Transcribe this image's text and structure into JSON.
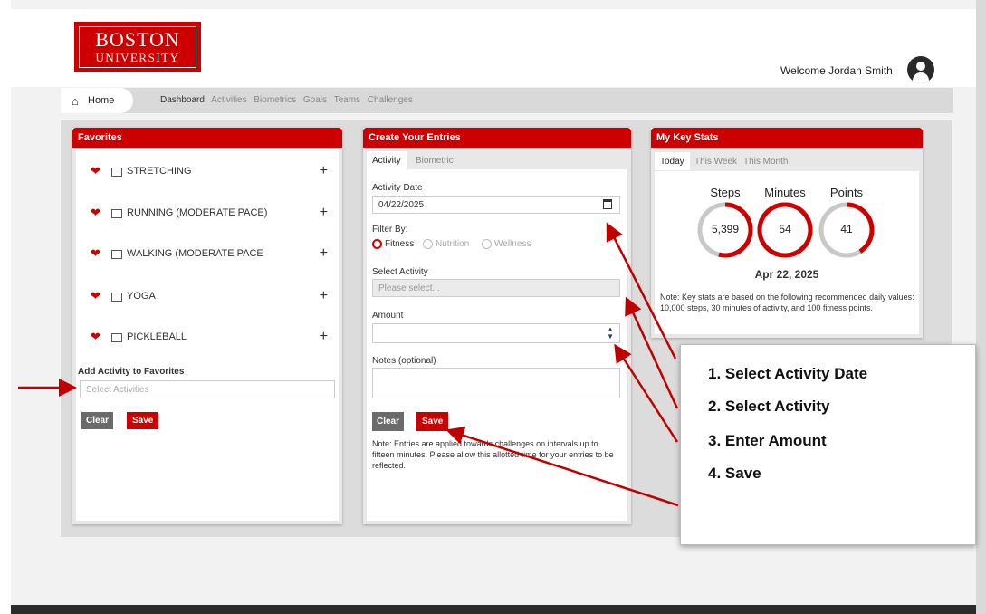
{
  "brand": {
    "line1": "BOSTON",
    "line2": "UNIVERSITY",
    "color": "#cc0000"
  },
  "header": {
    "welcome": "Welcome Jordan Smith"
  },
  "nav": {
    "home": "Home",
    "items": [
      "Dashboard",
      "Activities",
      "Biometrics",
      "Goals",
      "Teams",
      "Challenges"
    ]
  },
  "favorites": {
    "title": "Favorites",
    "items": [
      "STRETCHING",
      "RUNNING (MODERATE PACE)",
      "WALKING (MODERATE PACE",
      "YOGA",
      "PICKLEBALL"
    ],
    "add_label": "Add Activity to Favorites",
    "add_placeholder": "Select Activities",
    "clear": "Clear",
    "save": "Save"
  },
  "entries": {
    "title": "Create Your Entries",
    "tabs": [
      "Activity",
      "Biometric"
    ],
    "date_label": "Activity Date",
    "date_value": "04/22/2025",
    "filter_label": "Filter By:",
    "filter_options": [
      "Fitness",
      "Nutrition",
      "Wellness"
    ],
    "select_label": "Select Activity",
    "select_placeholder": "Please select...",
    "amount_label": "Amount",
    "notes_label": "Notes (optional)",
    "clear": "Clear",
    "save": "Save",
    "note": "Note: Entries are applied towards challenges on intervals up to fifteen minutes. Please allow this allotted time for your entries to be reflected."
  },
  "stats": {
    "title": "My Key Stats",
    "tabs": [
      "Today",
      "This Week",
      "This Month"
    ],
    "labels": [
      "Steps",
      "Minutes",
      "Points"
    ],
    "values": [
      "5,399",
      "54",
      "41"
    ],
    "progress": [
      0.54,
      1.0,
      0.41
    ],
    "date": "Apr 22, 2025",
    "note": "Note: Key stats are based on the following recommended daily values: 10,000 steps, 30 minutes of activity, and 100 fitness points."
  },
  "callout": {
    "steps": [
      "1. Select Activity Date",
      "2. Select Activity",
      "3. Enter Amount",
      "4. Save"
    ]
  }
}
